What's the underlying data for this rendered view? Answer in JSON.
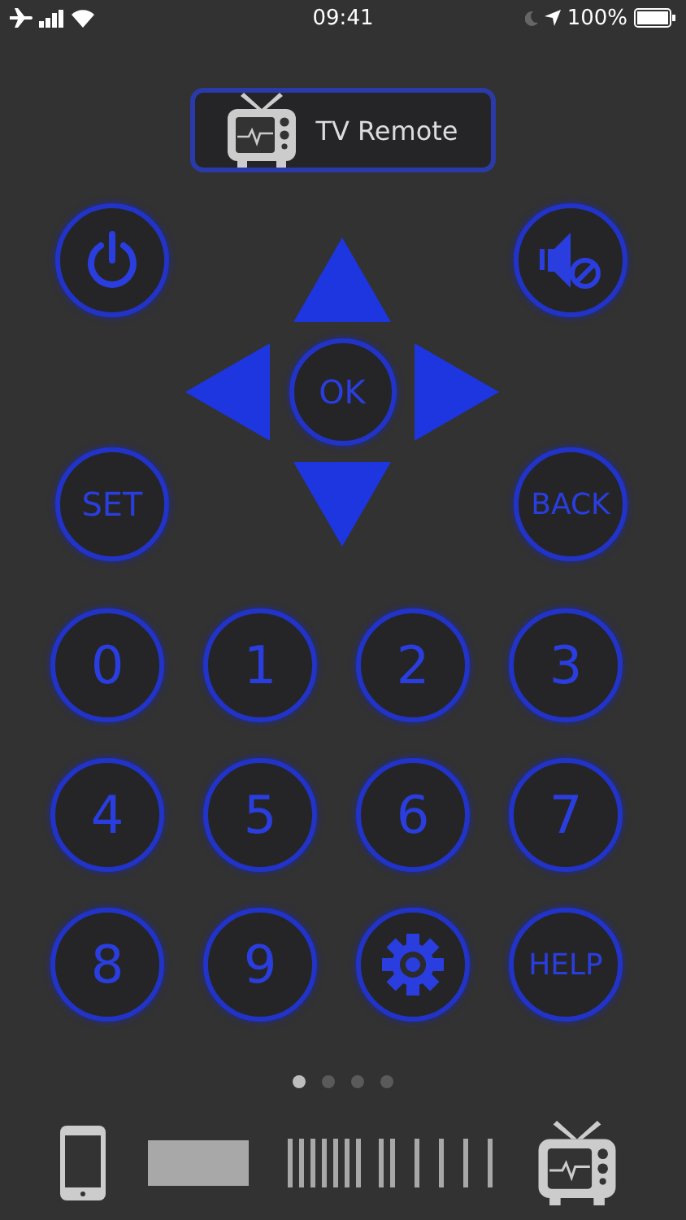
{
  "status_bar": {
    "time": "09:41",
    "battery": "100%"
  },
  "title_button": {
    "label": "TV Remote"
  },
  "top_buttons": [
    {
      "kind": "power"
    },
    {
      "kind": "mute"
    },
    {
      "kind": "text",
      "label": "SET"
    },
    {
      "kind": "text",
      "label": "BACK"
    }
  ],
  "dpad": {
    "ok": "OK"
  },
  "keypad": [
    {
      "kind": "text",
      "label": "0"
    },
    {
      "kind": "text",
      "label": "1"
    },
    {
      "kind": "text",
      "label": "2"
    },
    {
      "kind": "text",
      "label": "3"
    },
    {
      "kind": "text",
      "label": "4"
    },
    {
      "kind": "text",
      "label": "5"
    },
    {
      "kind": "text",
      "label": "6"
    },
    {
      "kind": "text",
      "label": "7"
    },
    {
      "kind": "text",
      "label": "8"
    },
    {
      "kind": "text",
      "label": "9"
    },
    {
      "kind": "settings"
    },
    {
      "kind": "small",
      "label": "HELP"
    }
  ],
  "pages": [
    {
      "selected": true
    },
    {
      "selected": false
    },
    {
      "selected": false
    },
    {
      "selected": false
    }
  ],
  "toolbar": [
    {
      "kind": "phone"
    },
    {
      "kind": "block"
    },
    {
      "kind": "bars"
    },
    {
      "kind": "tv"
    }
  ]
}
